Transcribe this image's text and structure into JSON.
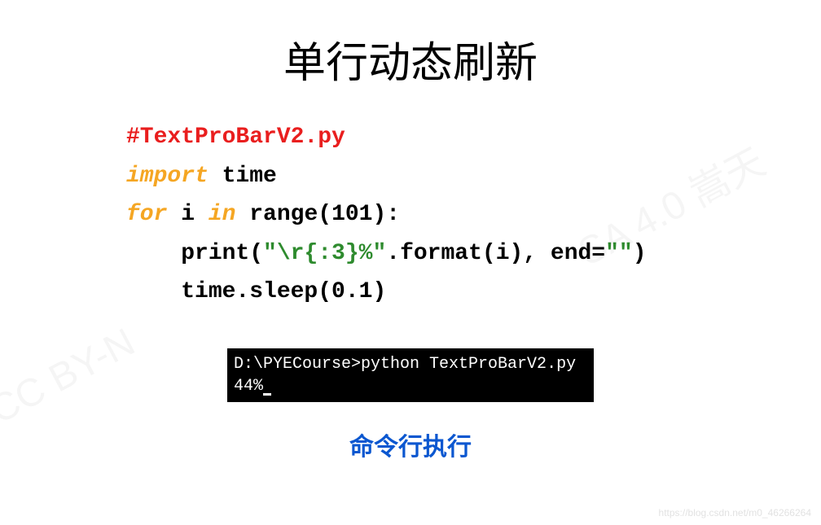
{
  "title": "单行动态刷新",
  "code": {
    "line1_comment": "#TextProBarV2.py",
    "line2_kw": "import",
    "line2_rest": " time",
    "line3_for": "for",
    "line3_i": " i ",
    "line3_in": "in",
    "line3_rest": " range(101):",
    "line4_indent": "    print(",
    "line4_str1": "\"\\r{:3}%\"",
    "line4_mid": ".format(i), end=",
    "line4_str2": "\"\"",
    "line4_close": ")",
    "line5": "    time.sleep(0.1)"
  },
  "terminal": {
    "line1": "D:\\PYECourse>python TextProBarV2.py",
    "line2": " 44%"
  },
  "subtitle": "命令行执行",
  "watermark1": "SA 4.0 嵩天",
  "watermark2": "CC BY-N",
  "footer_watermark": "https://blog.csdn.net/m0_46266264"
}
